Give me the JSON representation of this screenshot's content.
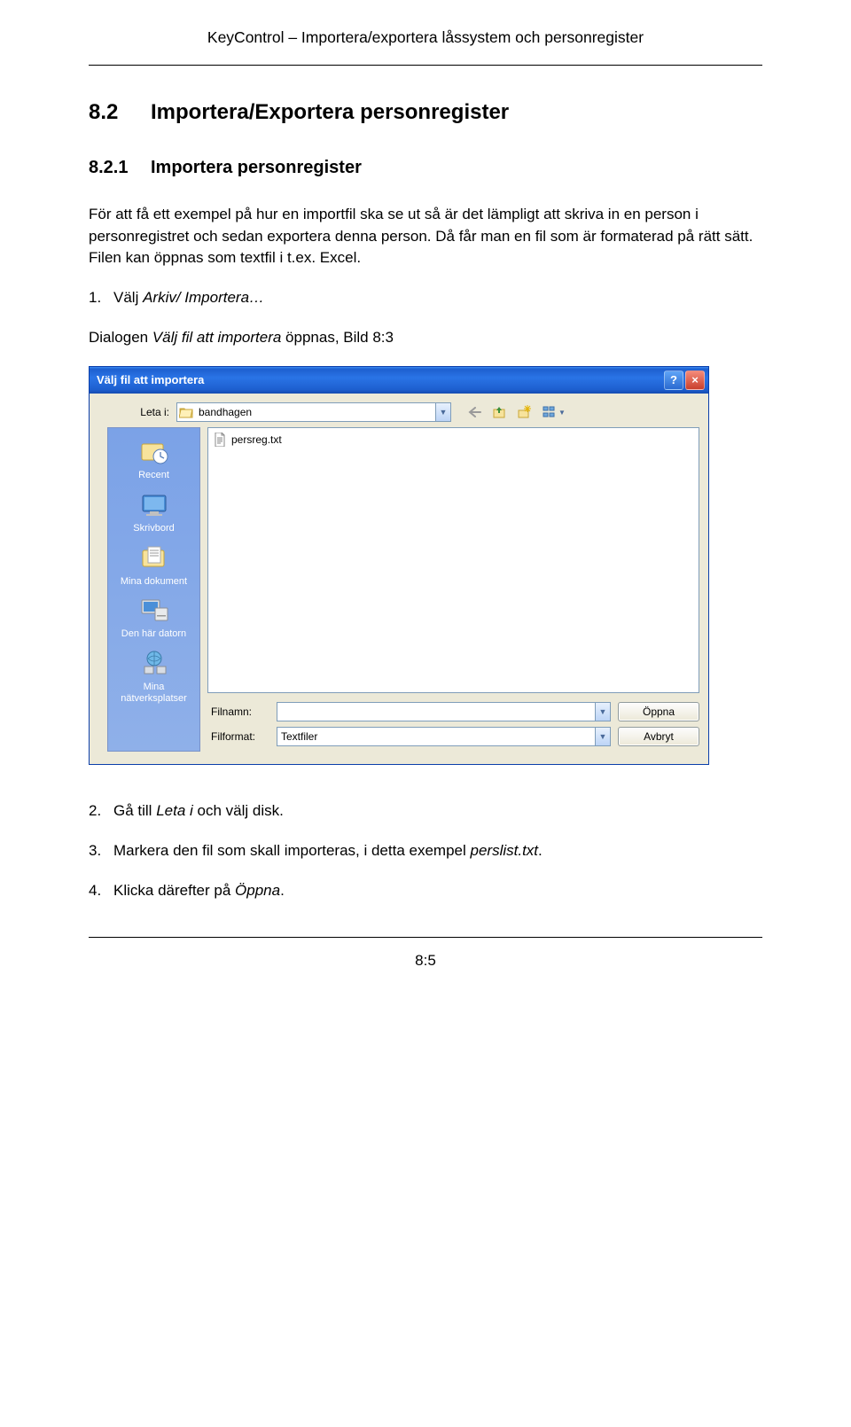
{
  "header": "KeyControl – Importera/exportera låssystem och personregister",
  "section": {
    "num": "8.2",
    "title": "Importera/Exportera personregister"
  },
  "subsection": {
    "num": "8.2.1",
    "title": "Importera personregister"
  },
  "intro": "För att få ett exempel på hur en importfil ska se ut så är det lämpligt att skriva in en person i personregistret och sedan exportera denna person. Då får man en fil som är formaterad på rätt sätt. Filen kan öppnas som textfil i t.ex. Excel.",
  "steps": {
    "s1_num": "1.",
    "s1_a": "Välj ",
    "s1_b": "Arkiv/ Importera…",
    "caption_a": "Dialogen ",
    "caption_b": "Välj fil att importera",
    "caption_c": " öppnas, Bild 8:3",
    "s2_num": "2.",
    "s2_a": "Gå till ",
    "s2_b": "Leta i",
    "s2_c": " och välj disk.",
    "s3_num": "3.",
    "s3_a": "Markera den fil som skall importeras, i detta exempel ",
    "s3_b": "perslist.txt",
    "s3_c": ".",
    "s4_num": "4.",
    "s4_a": "Klicka därefter på ",
    "s4_b": "Öppna",
    "s4_c": "."
  },
  "dialog": {
    "title": "Välj fil att importera",
    "help": "?",
    "close": "×",
    "leta_label": "Leta i:",
    "leta_value": "bandhagen",
    "places": {
      "recent": "Recent",
      "desktop": "Skrivbord",
      "mydocs": "Mina dokument",
      "mycomp": "Den här datorn",
      "network": "Mina nätverksplatser"
    },
    "file_item": "persreg.txt",
    "filename_label": "Filnamn:",
    "filename_value": "",
    "format_label": "Filformat:",
    "format_value": "Textfiler",
    "open_btn": "Öppna",
    "cancel_btn": "Avbryt"
  },
  "footer": "8:5"
}
